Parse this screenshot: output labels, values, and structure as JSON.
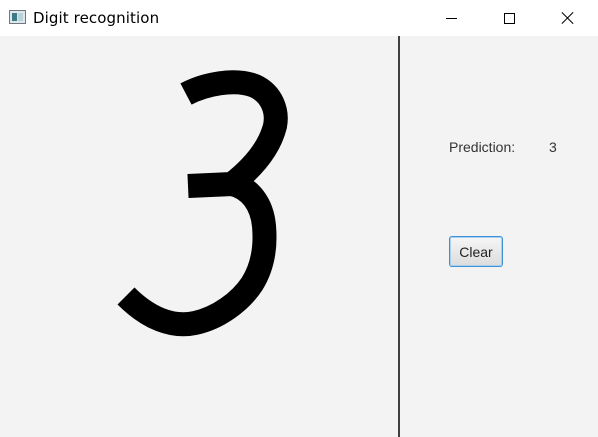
{
  "window": {
    "title": "Digit recognition",
    "icon": "app-window-icon",
    "controls": [
      "minimize-icon",
      "maximize-icon",
      "close-icon"
    ]
  },
  "panel": {
    "prediction_label": "Prediction:",
    "prediction_value": "3",
    "clear_label": "Clear"
  },
  "canvas": {
    "stroke_color": "#000000",
    "background_color": "#f3f3f3",
    "drawn_digit": "3"
  },
  "colors": {
    "divider": "#404040",
    "button_focus_border": "#3d8fd6"
  }
}
